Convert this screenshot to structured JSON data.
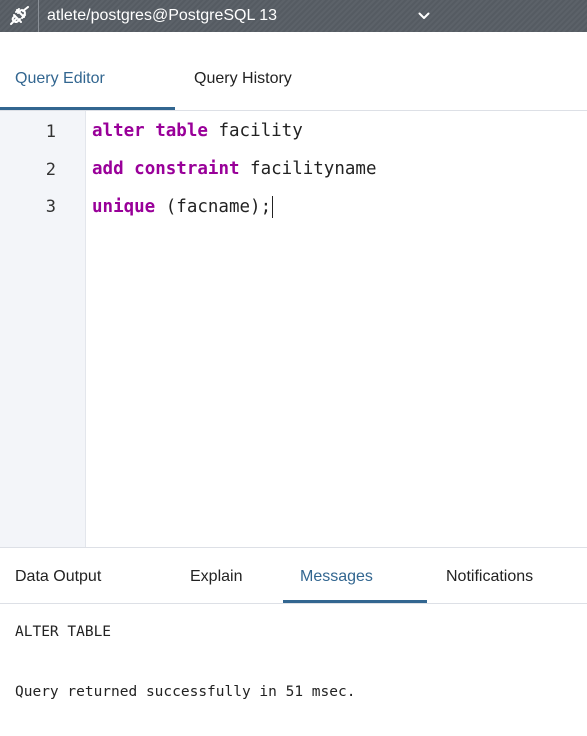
{
  "connection": {
    "icon": "disconnected-plug-icon",
    "label": "atlete/postgres@PostgreSQL 13"
  },
  "editor_tabs": [
    {
      "label": "Query Editor",
      "active": true
    },
    {
      "label": "Query History",
      "active": false
    }
  ],
  "editor": {
    "lines": [
      {
        "number": "1",
        "keyword1": "alter",
        "keyword2": "table",
        "rest": " facility"
      },
      {
        "number": "2",
        "keyword1": "add",
        "keyword2": "constraint",
        "rest": " facilityname"
      },
      {
        "number": "3",
        "keyword1": "unique",
        "rest": " (facname);"
      }
    ]
  },
  "result_tabs": [
    {
      "label": "Data Output",
      "active": false
    },
    {
      "label": "Explain",
      "active": false
    },
    {
      "label": "Messages",
      "active": true
    },
    {
      "label": "Notifications",
      "active": false
    }
  ],
  "messages": {
    "line1": "ALTER TABLE",
    "line2": "Query returned successfully in 51 msec."
  },
  "colors": {
    "accent": "#326690",
    "keyword": "#990099",
    "connection_bar": "#555b62"
  }
}
